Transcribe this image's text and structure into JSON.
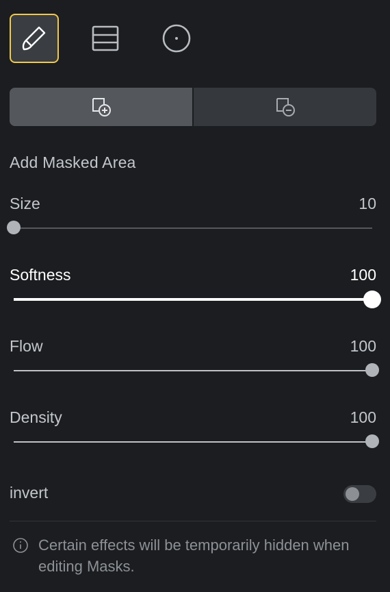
{
  "tools": [
    {
      "name": "brush",
      "icon": "brush-icon",
      "active": true
    },
    {
      "name": "linear",
      "icon": "linear-gradient-icon",
      "active": false
    },
    {
      "name": "radial",
      "icon": "radial-gradient-icon",
      "active": false
    }
  ],
  "segment": {
    "add_icon": "add-mask-icon",
    "subtract_icon": "subtract-mask-icon",
    "selected": "add"
  },
  "section_title": "Add Masked Area",
  "sliders": [
    {
      "label": "Size",
      "value": "10",
      "fraction": 0.0
    },
    {
      "label": "Softness",
      "value": "100",
      "fraction": 1.0
    },
    {
      "label": "Flow",
      "value": "100",
      "fraction": 1.0
    },
    {
      "label": "Density",
      "value": "100",
      "fraction": 1.0
    }
  ],
  "invert": {
    "label": "invert",
    "on": false
  },
  "note": {
    "icon": "info-icon",
    "text": "Certain effects will be temporarily hidden when editing Masks."
  },
  "colors": {
    "accent": "#f2c94c",
    "background": "#1b1d20"
  }
}
